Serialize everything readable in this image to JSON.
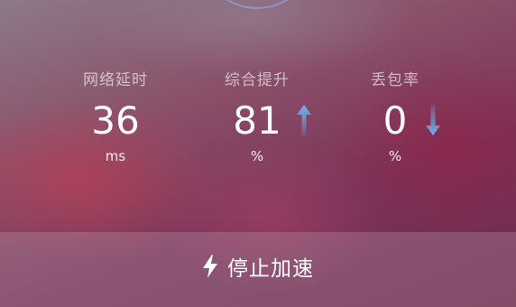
{
  "stats": {
    "latency": {
      "label": "网络延时",
      "value": "36",
      "unit": "ms"
    },
    "boost": {
      "label": "综合提升",
      "value": "81",
      "unit": "%",
      "trend_icon": "arrow-up-icon"
    },
    "packet_loss": {
      "label": "丢包率",
      "value": "0",
      "unit": "%",
      "trend_icon": "arrow-down-icon"
    }
  },
  "action": {
    "label": "停止加速",
    "icon": "lightning-bolt-icon"
  },
  "colors": {
    "accent_blue": "#5aa7f0",
    "text": "#ffffff",
    "label_text": "#cdb7c3"
  }
}
